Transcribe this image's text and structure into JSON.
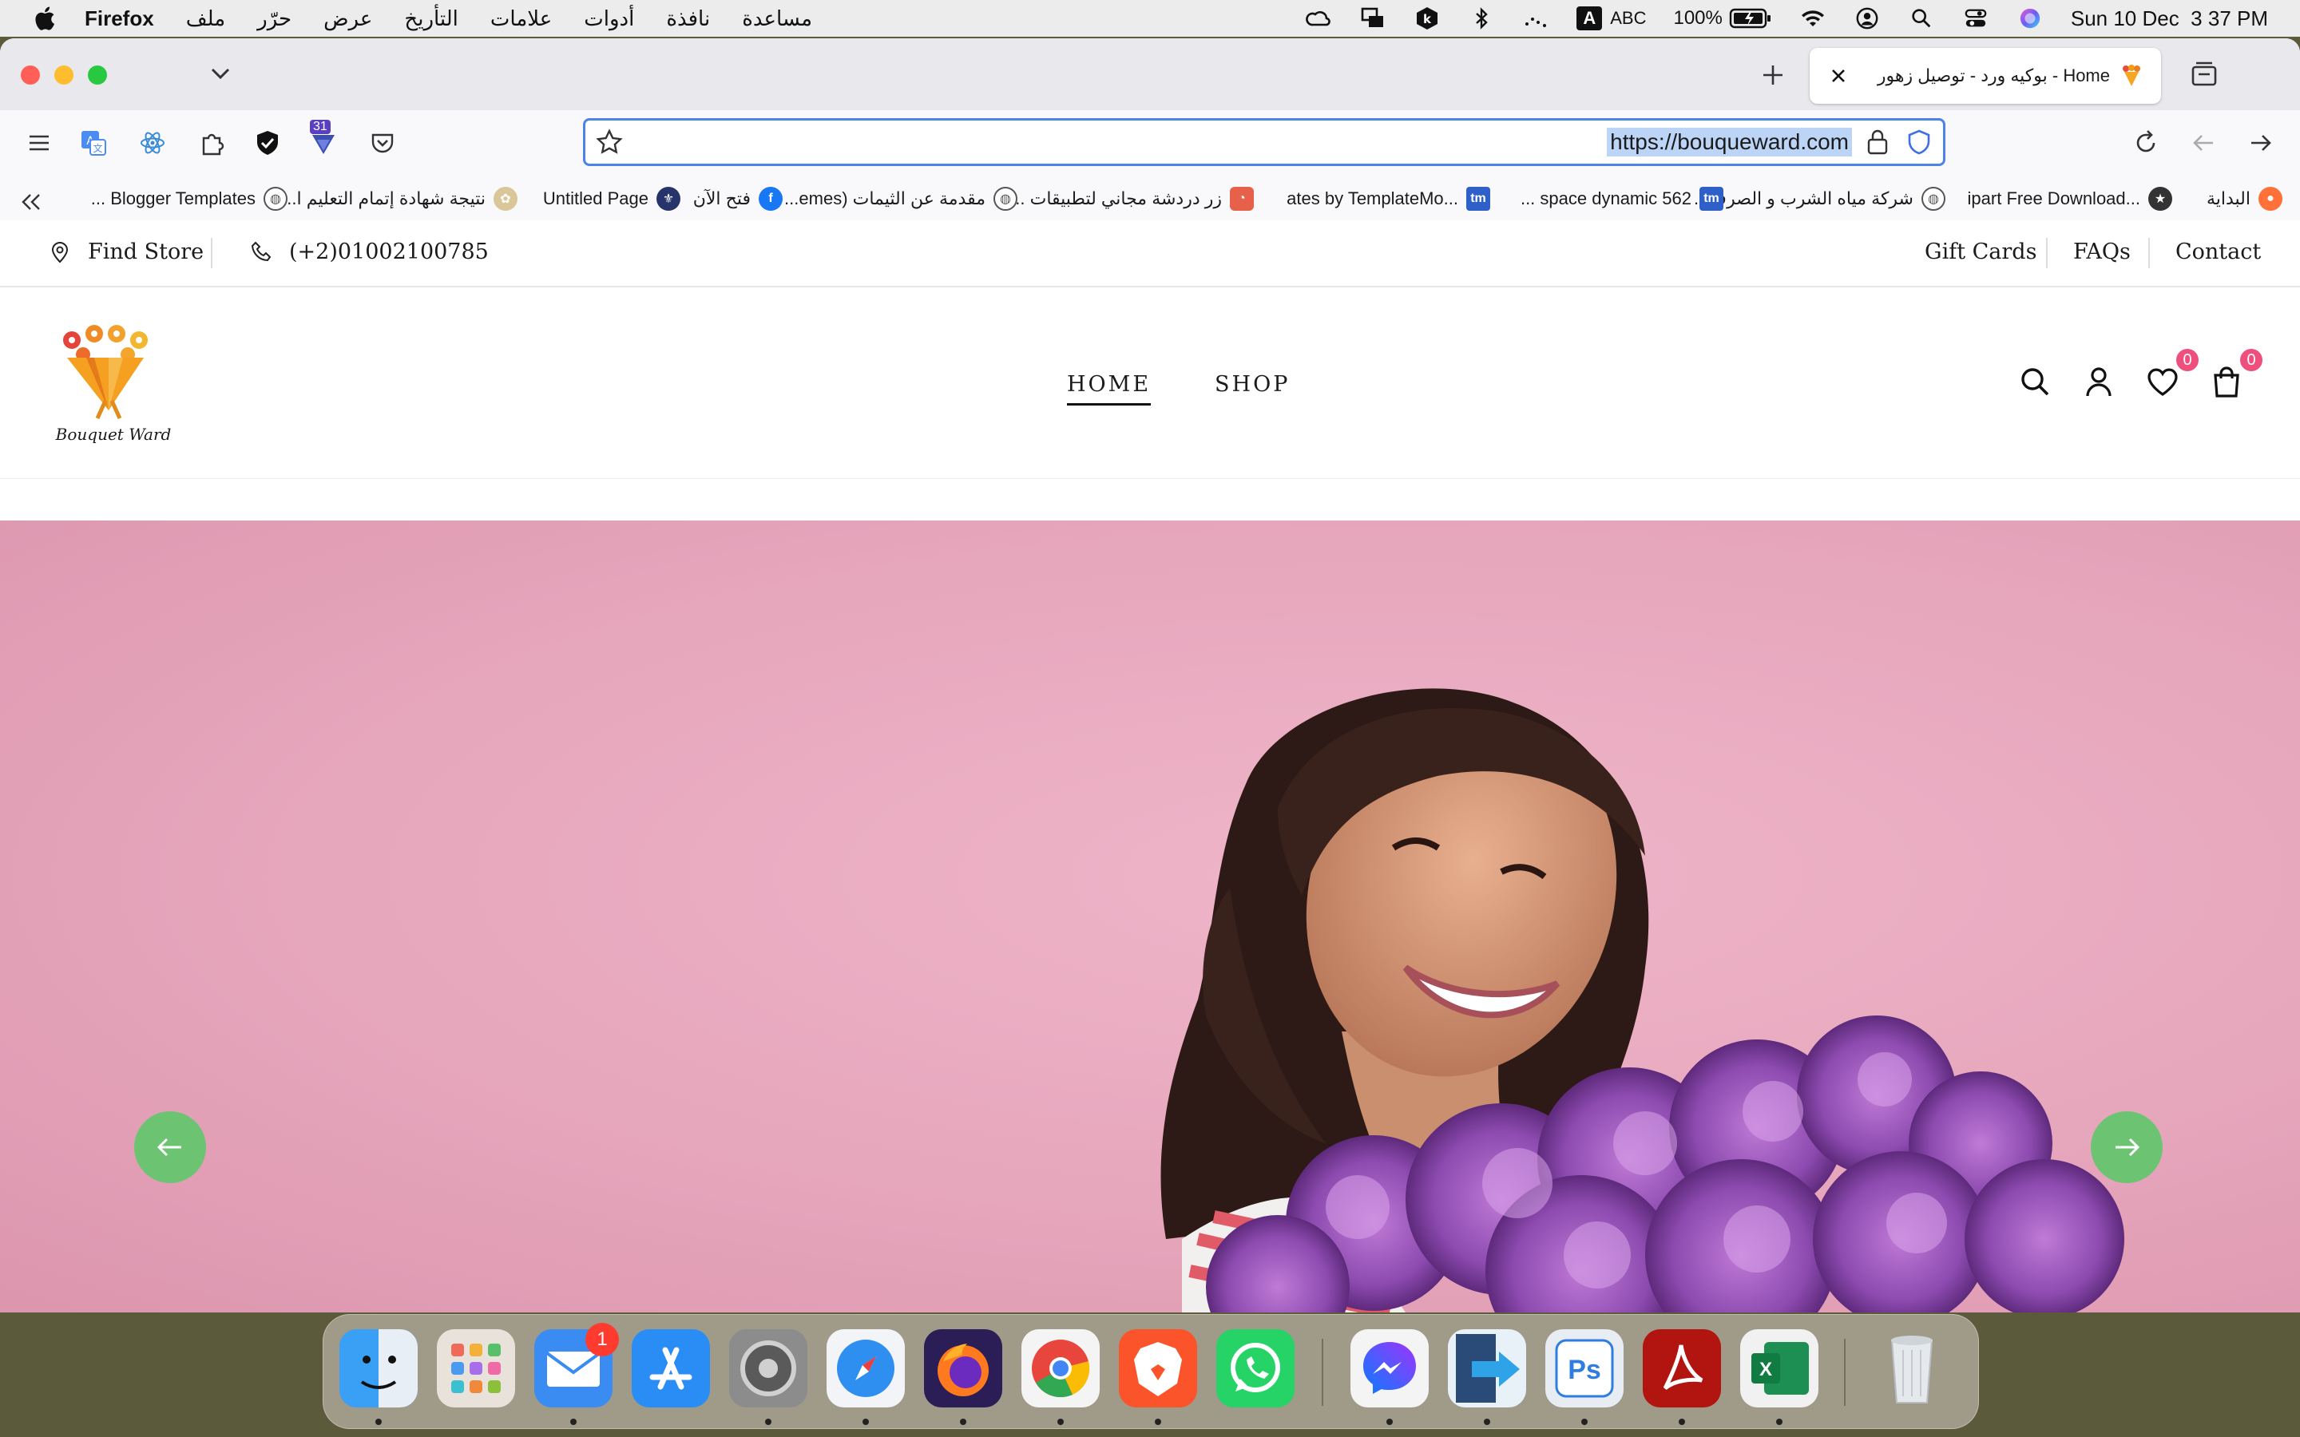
{
  "menubar": {
    "app_name": "Firefox",
    "menus": [
      "ملف",
      "حرّر",
      "عرض",
      "التأريخ",
      "علامات",
      "أدوات",
      "نافذة",
      "مساعدة"
    ],
    "input_source": "ABC",
    "input_key": "A",
    "battery": "100%",
    "datetime": "Sun 10 Dec  3 37 PM"
  },
  "browser": {
    "tab": {
      "title": "Home - بوكيه ورد - توصيل زهور"
    },
    "url": "https://bouqueward.com",
    "extension_badge": "31",
    "bookmarks": [
      "البداية",
      "...ipart Free Download",
      "شركة مياه الشرب و الصرف...",
      "562 space dynamic ...",
      "...ates by TemplateMo",
      "زر دردشة مجاني لتطبيقات ...",
      "مقدمة عن الثيمات (emes...",
      "فتح الآن",
      "Untitled Page",
      "نتيجة شهادة إتمام التعليم ا...",
      "Blogger Templates ..."
    ],
    "bookmark_tm": "tm"
  },
  "site": {
    "topbar": {
      "find_store": "Find Store",
      "phone": "(+2)01002100785",
      "gift_cards": "Gift Cards",
      "faqs": "FAQs",
      "contact": "Contact"
    },
    "logo_text": "Bouquet Ward",
    "nav": {
      "home": "HOME",
      "shop": "SHOP"
    },
    "wishlist_count": "0",
    "cart_count": "0",
    "colors": {
      "accent": "#6cc472",
      "badge": "#ee4f7c",
      "hero_bg": "#e6a6bc"
    }
  },
  "dock": {
    "mail_badge": "1"
  }
}
